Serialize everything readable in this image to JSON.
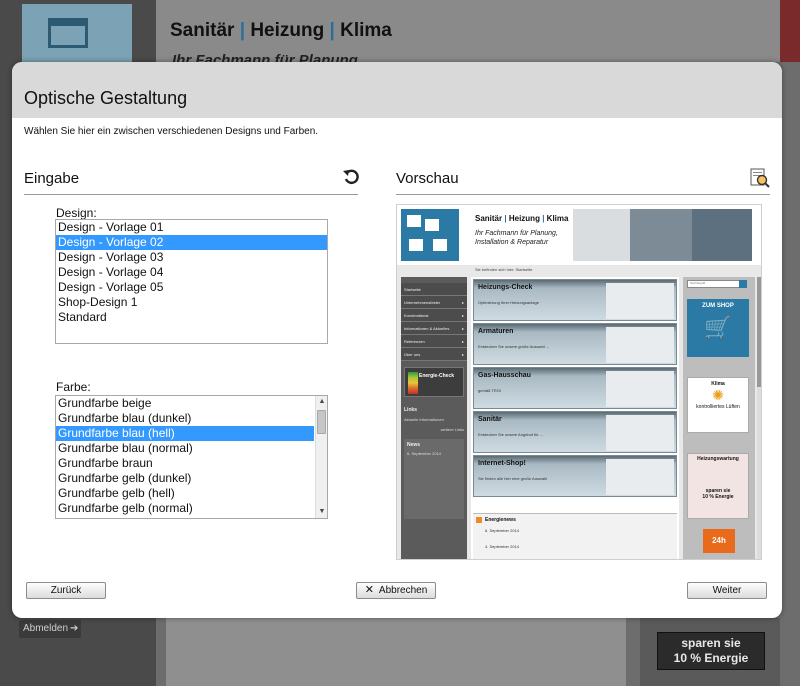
{
  "background": {
    "title_parts": [
      "Sanitär",
      "Heizung",
      "Klima"
    ],
    "title_separator": "|",
    "subtitle": "Ihr Fachmann für Planung",
    "logout_label": "Abmelden",
    "promo_line1": "sparen sie",
    "promo_line2": "10 % Energie"
  },
  "dialog": {
    "title": "Optische Gestaltung",
    "description": "Wählen Sie hier ein zwischen verschiedenen Designs und Farben.",
    "input_heading": "Eingabe",
    "preview_heading": "Vorschau",
    "reset_icon": "undo-icon",
    "preview_icon": "preview-zoom-icon",
    "design_label": "Design:",
    "design_options": [
      "Design - Vorlage 01",
      "Design - Vorlage 02",
      "Design - Vorlage 03",
      "Design - Vorlage 04",
      "Design - Vorlage 05",
      "Shop-Design 1",
      "Standard"
    ],
    "design_selected": "Design - Vorlage 02",
    "color_label": "Farbe:",
    "color_options": [
      "Grundfarbe beige",
      "Grundfarbe blau (dunkel)",
      "Grundfarbe blau (hell)",
      "Grundfarbe blau (normal)",
      "Grundfarbe braun",
      "Grundfarbe gelb (dunkel)",
      "Grundfarbe gelb (hell)",
      "Grundfarbe gelb (normal)"
    ],
    "color_selected": "Grundfarbe blau (hell)",
    "buttons": {
      "back": "Zurück",
      "cancel": "Abbrechen",
      "next": "Weiter"
    },
    "selection_color": "#3399ff"
  },
  "preview": {
    "title_parts": [
      "Sanitär",
      "Heizung",
      "Klima"
    ],
    "subtitle_line1": "Ihr Fachmann für Planung,",
    "subtitle_line2": "Installation & Reparatur",
    "breadcrumb": "Sie befinden sich hier: Startseite",
    "nav": [
      "Startseite",
      "Unternehmensfelder",
      "Kundendienst",
      "Informationen & Aktuelles",
      "Referenzen",
      "Über uns"
    ],
    "energy_check": "Energie-Check",
    "links_heading": "Links",
    "links_text": "Aktuelle Informationen",
    "links_more": "weitere Links",
    "news_heading": "News",
    "news_text": "6. September 2014",
    "cards": [
      {
        "title": "Heizungs-Check",
        "text": "Optimierung Ihrer Heizungsanlage"
      },
      {
        "title": "Armaturen",
        "text": "Entdecken Sie unsere große Auswahl ..."
      },
      {
        "title": "Gas-Hausschau",
        "text": "gemäß TRGI"
      },
      {
        "title": "Sanitär",
        "text": "Entdecken Sie unsere Angebot für ..."
      },
      {
        "title": "Internet-Shop!",
        "text": "Sie finden alle hier eine große Auswahl"
      }
    ],
    "energienews_heading": "Energienews",
    "energienews_items": [
      "6. September 2014",
      "4. September 2014"
    ],
    "search_placeholder": "Suchbegriff",
    "shop_label": "ZUM SHOP",
    "klima_label": "Klima",
    "klima_caption": "kontrolliertes Lüften",
    "heizungswartung_label": "Heizungswartung",
    "sparen_line1": "sparen sie",
    "sparen_line2": "10 % Energie",
    "badge_24h": "24h"
  }
}
